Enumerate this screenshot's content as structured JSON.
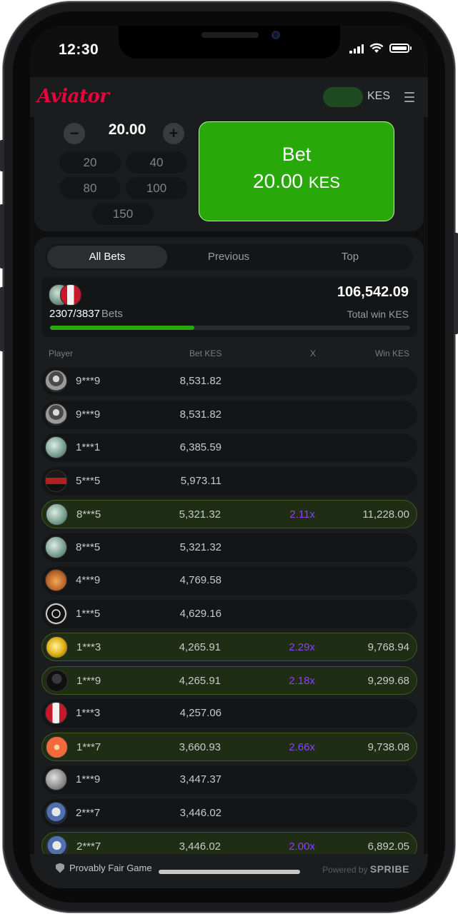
{
  "status_bar": {
    "time": "12:30"
  },
  "header": {
    "logo": "Aviator",
    "currency": "KES"
  },
  "bet_panel": {
    "amount": "20.00",
    "minus": "−",
    "plus": "+",
    "quick_amounts": [
      "20",
      "40",
      "80",
      "100",
      "150"
    ],
    "bet_label": "Bet",
    "bet_amount": "20.00",
    "bet_currency": "KES"
  },
  "tabs": [
    "All Bets",
    "Previous",
    "Top"
  ],
  "summary": {
    "count": "2307/3837",
    "bets_label": "Bets",
    "total": "106,542.09",
    "total_label": "Total win KES",
    "progress": 0.4
  },
  "columns": {
    "player": "Player",
    "bet": "Bet KES",
    "x": "X",
    "win": "Win KES"
  },
  "rows": [
    {
      "player": "9***9",
      "bet": "8,531.82",
      "x": "",
      "win": "",
      "won": false,
      "avatar": "robot"
    },
    {
      "player": "9***9",
      "bet": "8,531.82",
      "x": "",
      "win": "",
      "won": false,
      "avatar": "robot"
    },
    {
      "player": "1***1",
      "bet": "6,385.59",
      "x": "",
      "win": "",
      "won": false,
      "avatar": "money"
    },
    {
      "player": "5***5",
      "bet": "5,973.11",
      "x": "",
      "win": "",
      "won": false,
      "avatar": "car"
    },
    {
      "player": "8***5",
      "bet": "5,321.32",
      "x": "2.11x",
      "win": "11,228.00",
      "won": true,
      "avatar": "money"
    },
    {
      "player": "8***5",
      "bet": "5,321.32",
      "x": "",
      "win": "",
      "won": false,
      "avatar": "money"
    },
    {
      "player": "4***9",
      "bet": "4,769.58",
      "x": "",
      "win": "",
      "won": false,
      "avatar": "bear"
    },
    {
      "player": "1***5",
      "bet": "4,629.16",
      "x": "",
      "win": "",
      "won": false,
      "avatar": "wheel"
    },
    {
      "player": "1***3",
      "bet": "4,265.91",
      "x": "2.29x",
      "win": "9,768.94",
      "won": true,
      "avatar": "gold"
    },
    {
      "player": "1***9",
      "bet": "4,265.91",
      "x": "2.18x",
      "win": "9,299.68",
      "won": true,
      "avatar": "hood"
    },
    {
      "player": "1***3",
      "bet": "4,257.06",
      "x": "",
      "win": "",
      "won": false,
      "avatar": "flag"
    },
    {
      "player": "1***7",
      "bet": "3,660.93",
      "x": "2.66x",
      "win": "9,738.08",
      "won": true,
      "avatar": "orange"
    },
    {
      "player": "1***9",
      "bet": "3,447.37",
      "x": "",
      "win": "",
      "won": false,
      "avatar": "moon"
    },
    {
      "player": "2***7",
      "bet": "3,446.02",
      "x": "",
      "win": "",
      "won": false,
      "avatar": "skull"
    },
    {
      "player": "2***7",
      "bet": "3,446.02",
      "x": "2.00x",
      "win": "6,892.05",
      "won": true,
      "avatar": "skull"
    }
  ],
  "footer": {
    "provably_fair": "Provably Fair Game",
    "powered_by": "Powered by",
    "brand": "SPRIBE"
  },
  "colors": {
    "accent_green": "#28a909",
    "logo_red": "#e50539",
    "multiplier_purple": "#913ef8",
    "panel": "#1b1c1d"
  },
  "icons": {
    "menu": "hamburger-icon",
    "shield": "shield-icon"
  }
}
